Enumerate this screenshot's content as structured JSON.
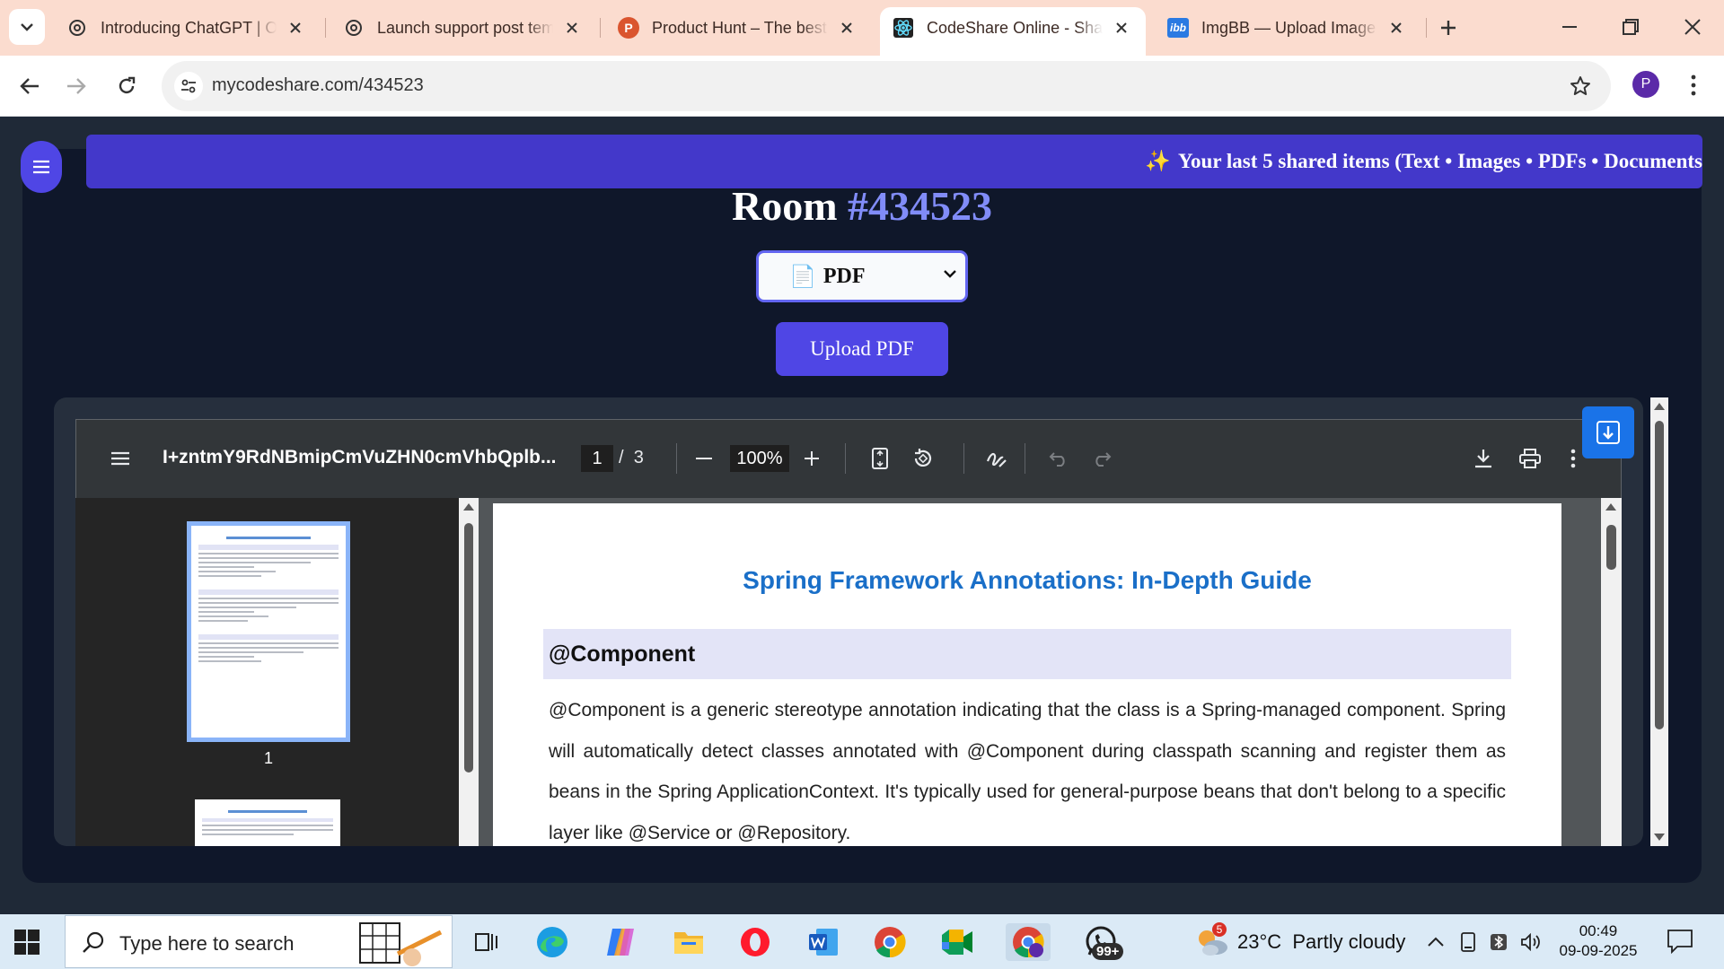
{
  "browser": {
    "tabs": [
      {
        "title": "Introducing ChatGPT | OpenAI",
        "icon": "openai-icon"
      },
      {
        "title": "Launch support post template",
        "icon": "openai-icon"
      },
      {
        "title": "Product Hunt – The best new products",
        "icon": "producthunt-icon",
        "glyph": "P"
      },
      {
        "title": "CodeShare Online - Share code",
        "icon": "react-icon",
        "active": true
      },
      {
        "title": "ImgBB — Upload Image",
        "icon": "imgbb-icon",
        "glyph": "ibb"
      }
    ],
    "url": "mycodeshare.com/434523",
    "profile_initial": "P"
  },
  "page": {
    "banner_icon": "✨",
    "banner_text": "Your last 5 shared items (Text • Images • PDFs • Documents",
    "room_label": "Room",
    "room_number": "#434523",
    "type_select": {
      "icon": "📄",
      "value": "PDF"
    },
    "upload_label": "Upload PDF"
  },
  "pdf_viewer": {
    "filename": "I+zntmY9RdNBmipCmVuZHN0cmVhbQplb...",
    "current_page": "1",
    "page_separator": "/",
    "total_pages": "3",
    "zoom": "100%",
    "thumbnail_label": "1",
    "doc_title": "Spring Framework Annotations: In-Depth Guide",
    "section_heading": "@Component",
    "section_body": "@Component is a generic stereotype annotation indicating that the class is a Spring-managed component. Spring will automatically detect classes annotated with @Component during classpath scanning and register them as beans in the Spring ApplicationContext. It's typically used for general-purpose beans that don't belong to a specific layer like @Service or @Repository."
  },
  "taskbar": {
    "search_placeholder": "Type here to search",
    "weather": "23°C  Partly cloudy",
    "weather_badge": "5",
    "whatsapp_badge": "99+",
    "time": "00:49",
    "date": "09-09-2025"
  },
  "colors": {
    "accent": "#4f46e5",
    "room_number": "#818cf8",
    "doc_title": "#1a6fc8",
    "tabbar": "#fbdccf"
  }
}
